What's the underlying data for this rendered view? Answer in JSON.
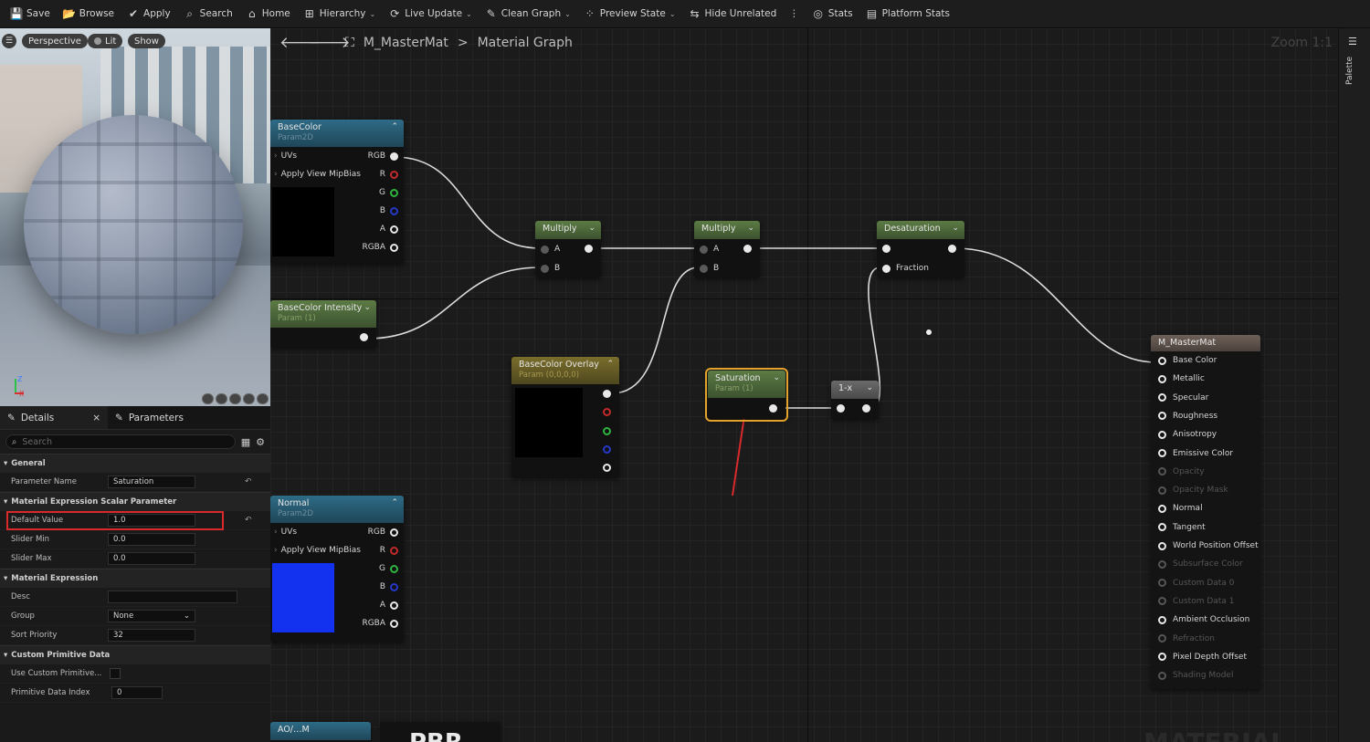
{
  "toolbar": {
    "items": [
      {
        "label": "Save",
        "icon": "save-icon",
        "caret": false
      },
      {
        "label": "Browse",
        "icon": "browse-icon",
        "caret": false
      },
      {
        "label": "Apply",
        "icon": "apply-icon",
        "caret": false
      },
      {
        "label": "Search",
        "icon": "search-icon",
        "caret": false
      },
      {
        "label": "Home",
        "icon": "home-icon",
        "caret": false
      },
      {
        "label": "Hierarchy",
        "icon": "hierarchy-icon",
        "caret": true
      },
      {
        "label": "Live Update",
        "icon": "live-update-icon",
        "caret": true
      },
      {
        "label": "Clean Graph",
        "icon": "clean-graph-icon",
        "caret": true
      },
      {
        "label": "Preview State",
        "icon": "preview-state-icon",
        "caret": true
      },
      {
        "label": "Hide Unrelated",
        "icon": "hide-unrelated-icon",
        "caret": false
      },
      {
        "label": "Stats",
        "icon": "stats-icon",
        "caret": false
      },
      {
        "label": "Platform Stats",
        "icon": "platform-stats-icon",
        "caret": false
      }
    ]
  },
  "viewport": {
    "perspective": "Perspective",
    "lit": "Lit",
    "show": "Show",
    "axis_z": "Z",
    "axis_x": "X"
  },
  "details": {
    "tab_details": "Details",
    "tab_parameters": "Parameters",
    "search_placeholder": "Search",
    "sections": {
      "general": "General",
      "scalar": "Material Expression Scalar Parameter",
      "expression": "Material Expression",
      "custom": "Custom Primitive Data"
    },
    "rows": {
      "parameter_name": {
        "label": "Parameter Name",
        "value": "Saturation"
      },
      "default_value": {
        "label": "Default Value",
        "value": "1.0"
      },
      "slider_min": {
        "label": "Slider Min",
        "value": "0.0"
      },
      "slider_max": {
        "label": "Slider Max",
        "value": "0.0"
      },
      "desc": {
        "label": "Desc",
        "value": ""
      },
      "group": {
        "label": "Group",
        "value": "None"
      },
      "sort_priority": {
        "label": "Sort Priority",
        "value": "32"
      },
      "use_custom": {
        "label": "Use Custom Primitive..."
      },
      "primitive_index": {
        "label": "Primitive Data Index",
        "value": "0"
      }
    }
  },
  "graph": {
    "breadcrumb_asset": "M_MasterMat",
    "breadcrumb_sep": ">",
    "breadcrumb_graph": "Material Graph",
    "zoom": "Zoom 1:1",
    "palette": "Palette",
    "nodes": {
      "basecolor": {
        "title": "BaseColor",
        "sub": "Param2D",
        "pins": {
          "uvs": "UVs",
          "mip": "Apply View MipBias",
          "rgb": "RGB",
          "r": "R",
          "g": "G",
          "b": "B",
          "a": "A",
          "rgba": "RGBA"
        }
      },
      "intensity": {
        "title": "BaseColor Intensity",
        "sub": "Param (1)"
      },
      "overlay": {
        "title": "BaseColor Overlay",
        "sub": "Param (0,0,0,0)"
      },
      "normal": {
        "title": "Normal",
        "sub": "Param2D",
        "pins": {
          "uvs": "UVs",
          "mip": "Apply View MipBias",
          "rgb": "RGB",
          "r": "R",
          "g": "G",
          "b": "B",
          "a": "A",
          "rgba": "RGBA"
        }
      },
      "multiply1": {
        "title": "Multiply",
        "a": "A",
        "b": "B"
      },
      "multiply2": {
        "title": "Multiply",
        "a": "A",
        "b": "B"
      },
      "desaturation": {
        "title": "Desaturation",
        "fraction": "Fraction"
      },
      "saturation": {
        "title": "Saturation",
        "sub": "Param (1)"
      },
      "oneminus": {
        "title": "1-x"
      },
      "aomask": {
        "title": "AO/…M"
      },
      "master": {
        "title": "M_MasterMat",
        "inputs": [
          {
            "label": "Base Color",
            "enabled": true
          },
          {
            "label": "Metallic",
            "enabled": true
          },
          {
            "label": "Specular",
            "enabled": true
          },
          {
            "label": "Roughness",
            "enabled": true
          },
          {
            "label": "Anisotropy",
            "enabled": true
          },
          {
            "label": "Emissive Color",
            "enabled": true
          },
          {
            "label": "Opacity",
            "enabled": false
          },
          {
            "label": "Opacity Mask",
            "enabled": false
          },
          {
            "label": "Normal",
            "enabled": true
          },
          {
            "label": "Tangent",
            "enabled": true
          },
          {
            "label": "World Position Offset",
            "enabled": true
          },
          {
            "label": "Subsurface Color",
            "enabled": false
          },
          {
            "label": "Custom Data 0",
            "enabled": false
          },
          {
            "label": "Custom Data 1",
            "enabled": false
          },
          {
            "label": "Ambient Occlusion",
            "enabled": true
          },
          {
            "label": "Refraction",
            "enabled": false
          },
          {
            "label": "Pixel Depth Offset",
            "enabled": true
          },
          {
            "label": "Shading Model",
            "enabled": false
          }
        ]
      }
    },
    "watermark_pbr": "PBR",
    "watermark_material": "MATERIAL"
  }
}
